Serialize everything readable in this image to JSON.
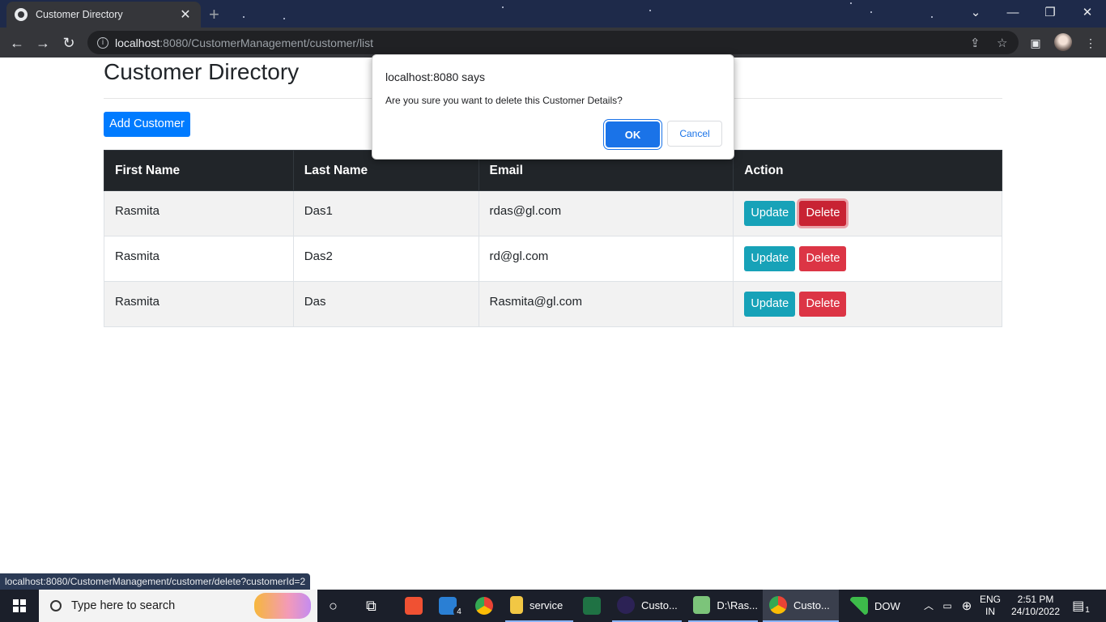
{
  "browser": {
    "tab_title": "Customer Directory",
    "tab_close": "✕",
    "new_tab": "+",
    "url_host": "localhost",
    "url_path": ":8080/CustomerManagement/customer/list",
    "window_controls": {
      "tab_search": "⌄",
      "minimize": "—",
      "restore": "❐",
      "close": "✕"
    },
    "toolbar_icons": {
      "share": "⇪",
      "bookmark": "☆",
      "side_panel": "▣",
      "menu": "⋮"
    }
  },
  "page": {
    "title": "Customer Directory",
    "add_button": "Add Customer",
    "table": {
      "headers": [
        "First Name",
        "Last Name",
        "Email",
        "Action"
      ],
      "rows": [
        {
          "first_name": "Rasmita",
          "last_name": "Das1",
          "email": "rdas@gl.com"
        },
        {
          "first_name": "Rasmita",
          "last_name": "Das2",
          "email": "rd@gl.com"
        },
        {
          "first_name": "Rasmita",
          "last_name": "Das",
          "email": "Rasmita@gl.com"
        }
      ],
      "update_label": "Update",
      "delete_label": "Delete"
    }
  },
  "dialog": {
    "title": "localhost:8080 says",
    "message": "Are you sure you want to delete this Customer Details?",
    "ok_label": "OK",
    "cancel_label": "Cancel"
  },
  "status_url": "localhost:8080/CustomerManagement/customer/delete?customerId=2",
  "taskbar": {
    "search_placeholder": "Type here to search",
    "mail_badge": "4",
    "items": [
      {
        "label": "service"
      },
      {
        "label": "Custo..."
      },
      {
        "label": "D:\\Ras..."
      },
      {
        "label": "Custo..."
      },
      {
        "label": "DOW"
      }
    ],
    "lang_top": "ENG",
    "lang_bottom": "IN",
    "time": "2:51 PM",
    "date": "24/10/2022",
    "notification_count": "1"
  },
  "colors": {
    "primary": "#007bff",
    "info": "#17a2b8",
    "danger": "#dc3545",
    "table_header": "#212529",
    "dialog_accent": "#1a73e8"
  }
}
